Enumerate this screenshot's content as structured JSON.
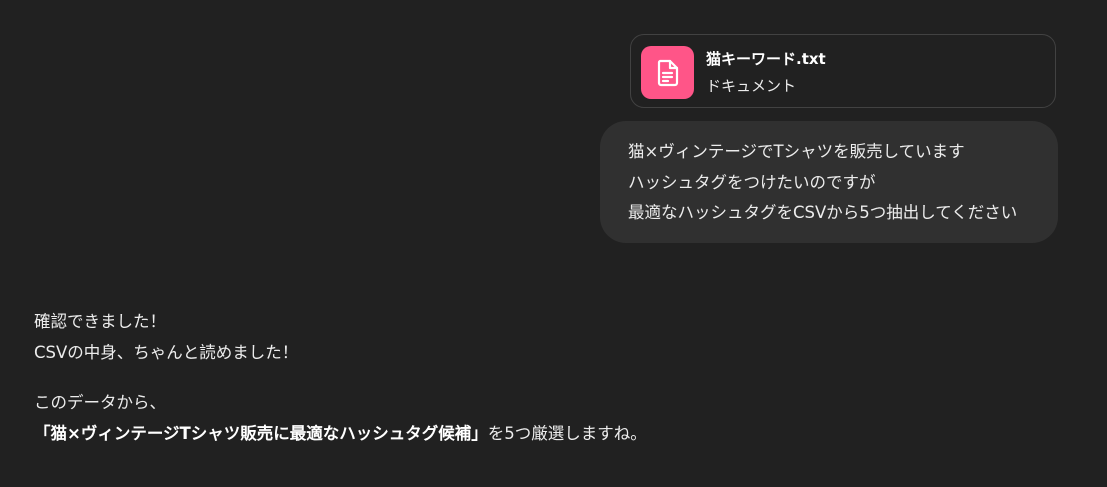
{
  "attachment": {
    "file_name": "猫キーワード.txt",
    "file_type": "ドキュメント",
    "icon": "document-icon",
    "icon_bg_color": "#ff5588"
  },
  "user_message": {
    "lines": [
      "猫×ヴィンテージでTシャツを販売しています",
      "ハッシュタグをつけたいのですが",
      "最適なハッシュタグをCSVから5つ抽出してください"
    ]
  },
  "assistant_message": {
    "paragraph1": [
      "確認できました！",
      "CSVの中身、ちゃんと読めました！"
    ],
    "paragraph2_line1": "このデータから、",
    "paragraph2_line2_bold": "「猫×ヴィンテージTシャツ販売に最適なハッシュタグ候補」",
    "paragraph2_line2_rest": "を5つ厳選しますね。"
  }
}
